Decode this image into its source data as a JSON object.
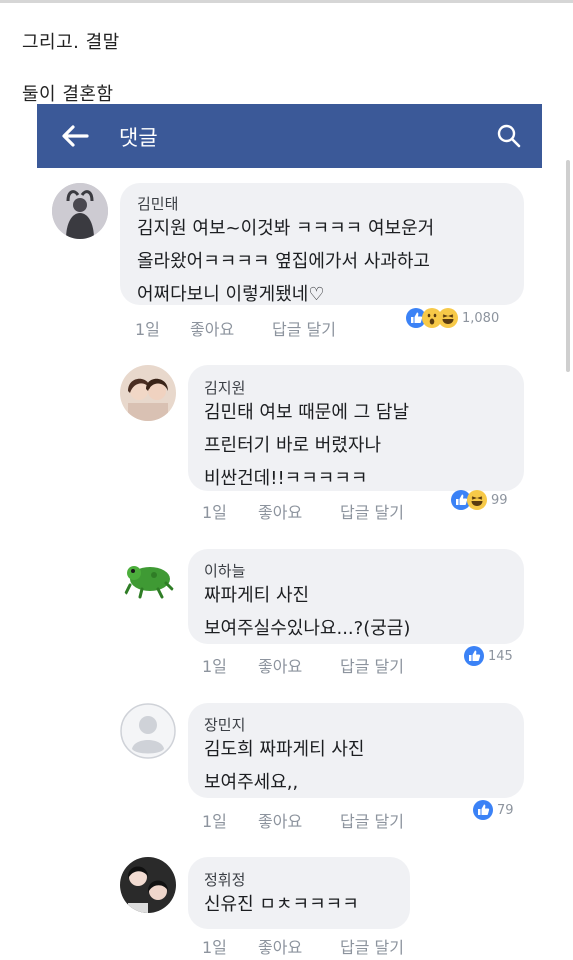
{
  "caption": {
    "line1": "그리고. 결말",
    "line2": "둘이 결혼함"
  },
  "header": {
    "title": "댓글",
    "color": "#3b5998"
  },
  "actions": {
    "like": "좋아요",
    "reply": "답글 달기"
  },
  "comments": [
    {
      "author": "김민태",
      "text": "김지원 여보~이것봐 ㅋㅋㅋㅋ 여보운거\n올라왔어ㅋㅋㅋㅋ 옆집에가서 사과하고\n어쩌다보니 이렇게됐네♡",
      "time": "1일",
      "reactions": [
        "like-icon",
        "wow-icon",
        "haha-icon"
      ],
      "count": "1,080"
    },
    {
      "author": "김지원",
      "text": "김민태 여보 때문에 그 담날\n프린터기 바로 버렸자나\n비싼건데!!ㅋㅋㅋㅋㅋ",
      "time": "1일",
      "reactions": [
        "like-icon",
        "haha-icon"
      ],
      "count": "99"
    },
    {
      "author": "이하늘",
      "text": "짜파게티 사진\n보여주실수있나요...?(궁금)",
      "time": "1일",
      "reactions": [
        "like-icon"
      ],
      "count": "145"
    },
    {
      "author": "장민지",
      "text": "김도희 짜파게티 사진\n보여주세요,,",
      "time": "1일",
      "reactions": [
        "like-icon"
      ],
      "count": "79"
    },
    {
      "author": "정휘정",
      "text": "신유진 ㅁㅊㅋㅋㅋㅋ",
      "time": "1일",
      "reactions": [],
      "count": ""
    }
  ]
}
